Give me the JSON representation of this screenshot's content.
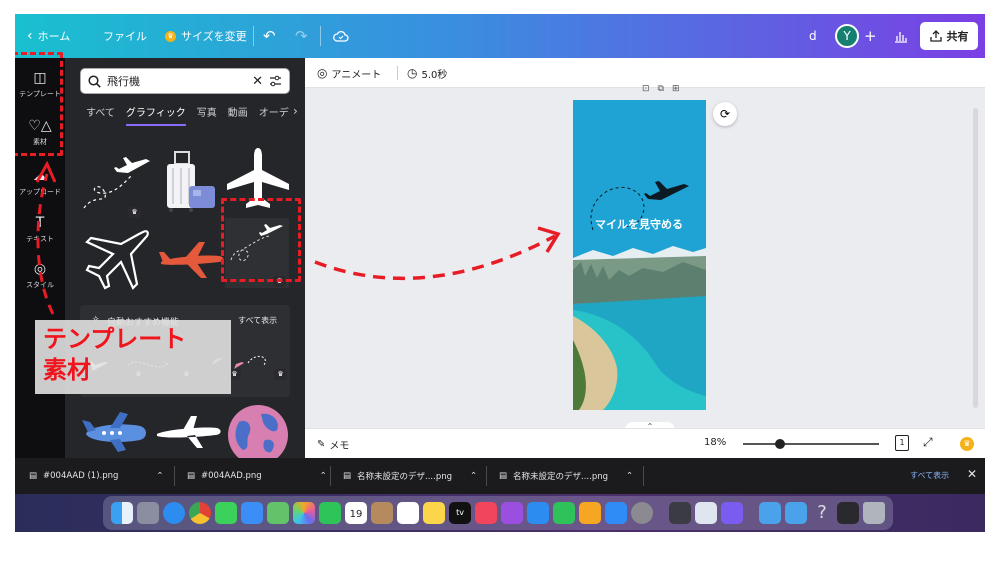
{
  "topbar": {
    "home": "ホーム",
    "file": "ファイル",
    "resize": "サイズを変更",
    "user_initial_small": "d",
    "avatar_initial": "Y",
    "share": "共有"
  },
  "rail": {
    "items": [
      {
        "label": "テンプレート",
        "icon": "template-icon"
      },
      {
        "label": "素材",
        "icon": "elements-icon"
      },
      {
        "label": "アップロード",
        "icon": "upload-icon"
      },
      {
        "label": "テキスト",
        "icon": "text-icon"
      },
      {
        "label": "スタイル",
        "icon": "style-icon"
      }
    ]
  },
  "panel": {
    "search_value": "飛行機",
    "tabs": [
      "すべて",
      "グラフィック",
      "写真",
      "動画",
      "オーデ"
    ],
    "active_tab": "グラフィック",
    "suggest_title": "自動おすすめ機能",
    "suggest_link": "すべて表示"
  },
  "canvas": {
    "animate": "アニメート",
    "duration": "5.0秒",
    "design_text": "マイルを見守める",
    "zoom": "18%",
    "page": "1",
    "notes": "メモ",
    "zoom_level": 0.27
  },
  "downloads": {
    "files": [
      "#004AAD (1).png",
      "#004AAD.png",
      "名称未設定のデザ....png",
      "名称未設定のデザ....png"
    ],
    "show_all": "すべて表示"
  },
  "annotation": {
    "line1": "テンプレート",
    "line2": "素材"
  },
  "dock": {
    "calendar_day": "19",
    "tv_label": "tv"
  },
  "colors": {
    "accent_purple": "#8b6cf6",
    "annotation_red": "#e81c24",
    "avatar_green": "#15806f"
  }
}
